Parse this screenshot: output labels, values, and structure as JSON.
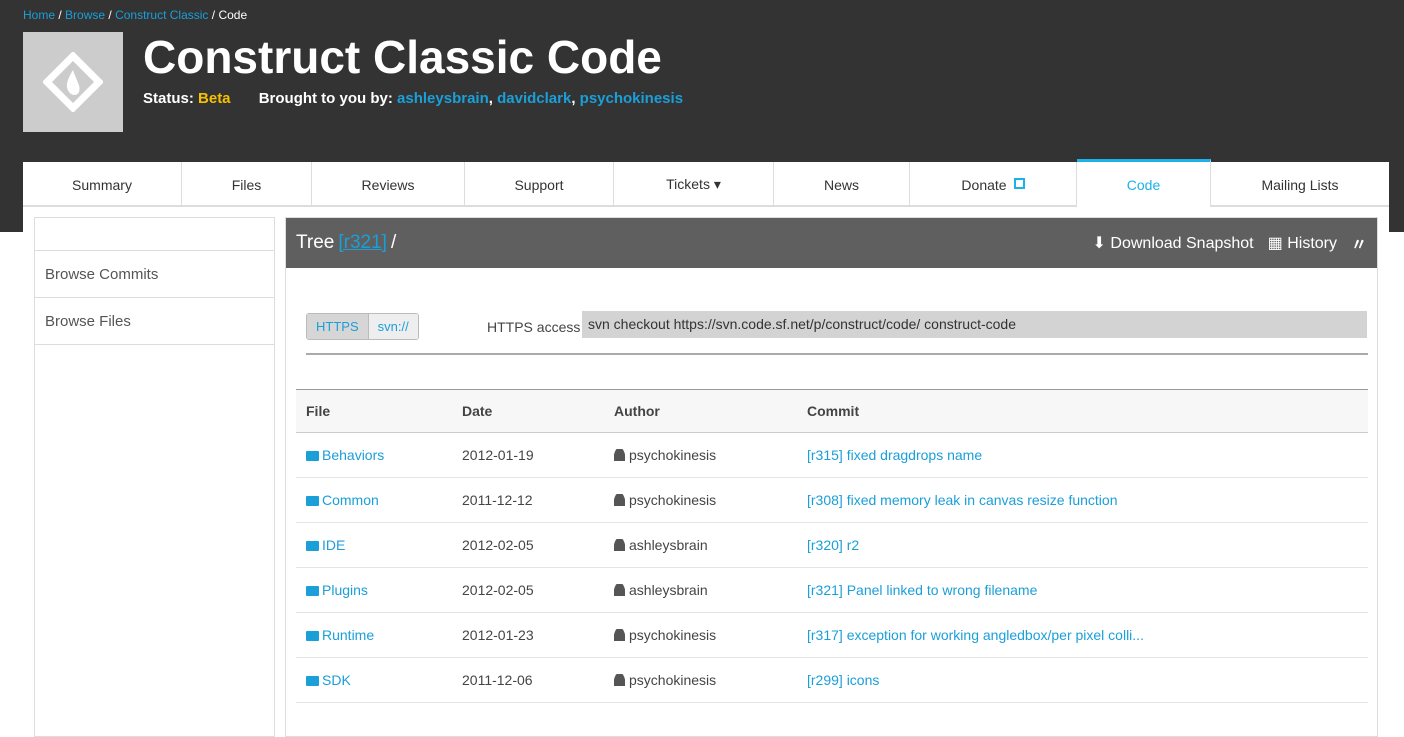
{
  "breadcrumb": {
    "items": [
      "Home",
      "Browse",
      "Construct Classic"
    ],
    "current": "Code"
  },
  "header": {
    "title": "Construct Classic Code",
    "status_label": "Status:",
    "status": "Beta",
    "brought_label": "Brought to you by:",
    "authors": [
      "ashleysbrain",
      "davidclark",
      "psychokinesis"
    ]
  },
  "tabs": [
    {
      "label": "Summary"
    },
    {
      "label": "Files"
    },
    {
      "label": "Reviews"
    },
    {
      "label": "Support"
    },
    {
      "label": "Tickets ▾"
    },
    {
      "label": "News"
    },
    {
      "label": "Donate"
    },
    {
      "label": "Code"
    },
    {
      "label": "Mailing Lists"
    }
  ],
  "sidebar": {
    "items": [
      {
        "label": "Browse Commits"
      },
      {
        "label": "Browse Files"
      }
    ]
  },
  "tree": {
    "title": "Tree",
    "rev": "[r321]",
    "path": "/",
    "download": "Download Snapshot",
    "history": "History"
  },
  "access": {
    "opt1": "HTTPS",
    "opt2": "svn://",
    "label": "HTTPS access",
    "command": "svn checkout https://svn.code.sf.net/p/construct/code/ construct-code"
  },
  "table": {
    "headers": [
      "File",
      "Date",
      "Author",
      "Commit"
    ],
    "rows": [
      [
        "Behaviors",
        "2012-01-19",
        "psychokinesis",
        "[r315] fixed dragdrops name"
      ],
      [
        "Common",
        "2011-12-12",
        "psychokinesis",
        "[r308] fixed memory leak in canvas resize function"
      ],
      [
        "IDE",
        "2012-02-05",
        "ashleysbrain",
        "[r320] r2"
      ],
      [
        "Plugins",
        "2012-02-05",
        "ashleysbrain",
        "[r321] Panel linked to wrong filename"
      ],
      [
        "Runtime",
        "2012-01-23",
        "psychokinesis",
        "[r317] exception for working angledbox/per pixel colli..."
      ],
      [
        "SDK",
        "2011-12-06",
        "psychokinesis",
        "[r299] icons"
      ]
    ]
  }
}
